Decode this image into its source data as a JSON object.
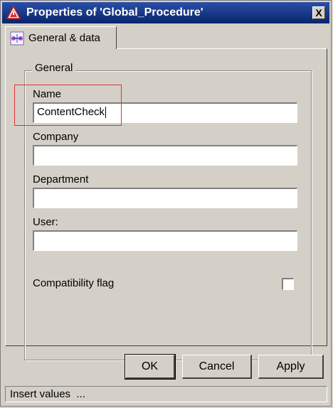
{
  "window": {
    "title": "Properties of 'Global_Procedure'",
    "title_icon": "warning-triangle-icon",
    "close_label": "X"
  },
  "tabs": [
    {
      "label": "General & data",
      "icon": "procedure-icon",
      "active": true
    }
  ],
  "group": {
    "label": "General"
  },
  "fields": {
    "name": {
      "label": "Name",
      "value": "ContentCheck"
    },
    "company": {
      "label": "Company",
      "value": ""
    },
    "department": {
      "label": "Department",
      "value": ""
    },
    "user": {
      "label": "User:",
      "value": ""
    }
  },
  "compatibility": {
    "label": "Compatibility flag",
    "checked": false
  },
  "buttons": {
    "ok": "OK",
    "cancel": "Cancel",
    "apply": "Apply"
  },
  "status": {
    "text": "Insert values  ..."
  },
  "colors": {
    "titlebar": "#0a246a",
    "highlight": "#e03030",
    "face": "#d4d0c8"
  }
}
